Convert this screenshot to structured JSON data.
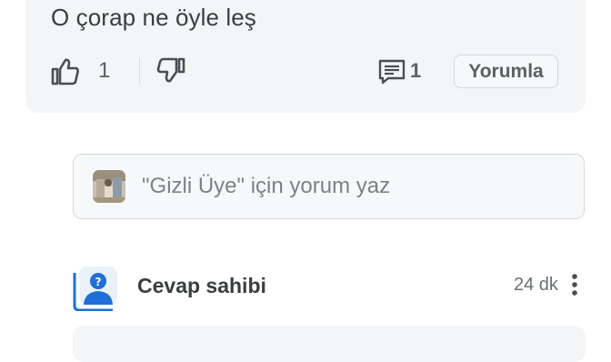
{
  "post": {
    "text": "O çorap ne öyle leş",
    "like_count": "1",
    "comment_count": "1",
    "comment_button_label": "Yorumla"
  },
  "comment_input": {
    "placeholder": "\"Gizli Üye\" için yorum yaz"
  },
  "answer": {
    "author_label": "Cevap sahibi",
    "time_ago": "24 dk"
  },
  "icons": {
    "like": "thumbs-up-icon",
    "dislike": "thumbs-down-icon",
    "comment": "comment-icon",
    "more": "more-vertical-icon",
    "avatar": "anonymous-avatar-icon"
  },
  "colors": {
    "card_background": "#f4f5f6",
    "text": "#3a3d42",
    "muted": "#7c8188",
    "avatar_blue": "#1e6fd9"
  }
}
